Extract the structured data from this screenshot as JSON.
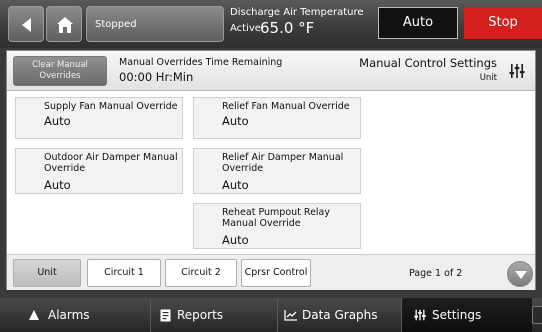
{
  "header": {
    "status": "Stopped",
    "discharge_air": {
      "label": "Discharge Air Temperature",
      "state": "Active",
      "value": "65.0 °F"
    },
    "auto_label": "Auto",
    "stop_label": "Stop",
    "colors": {
      "stop": "#d41f1f",
      "auto_bg": "#121212"
    },
    "icons": {
      "back": "back-arrow-icon",
      "home": "home-icon"
    }
  },
  "subheader": {
    "clear_button": "Clear Manual Overrides",
    "override_time_label": "Manual Overrides Time Remaining",
    "override_time_value": "00:00 Hr:Min",
    "title": "Manual Control Settings",
    "subtitle": "Unit",
    "icon": "sliders-icon"
  },
  "overrides": [
    {
      "label": "Supply Fan Manual Override",
      "value": "Auto"
    },
    {
      "label": "Relief Fan Manual Override",
      "value": "Auto"
    },
    {
      "label": "Outdoor Air Damper Manual Override",
      "value": "Auto"
    },
    {
      "label": "Relief Air Damper Manual Override",
      "value": "Auto"
    },
    {
      "label": "Reheat Pumpout Relay Manual Override",
      "value": "Auto"
    }
  ],
  "tabs": [
    {
      "label": "Unit",
      "active": true
    },
    {
      "label": "Circuit 1",
      "active": false
    },
    {
      "label": "Circuit 2",
      "active": false
    },
    {
      "label": "Cprsr Control",
      "active": false
    }
  ],
  "page_indicator": "Page 1 of 2",
  "bottom_nav": [
    {
      "label": "Alarms",
      "icon": "alarm-triangle-icon",
      "active": false
    },
    {
      "label": "Reports",
      "icon": "report-document-icon",
      "active": false
    },
    {
      "label": "Data Graphs",
      "icon": "graph-icon",
      "active": false
    },
    {
      "label": "Settings",
      "icon": "sliders-icon",
      "active": true
    }
  ]
}
